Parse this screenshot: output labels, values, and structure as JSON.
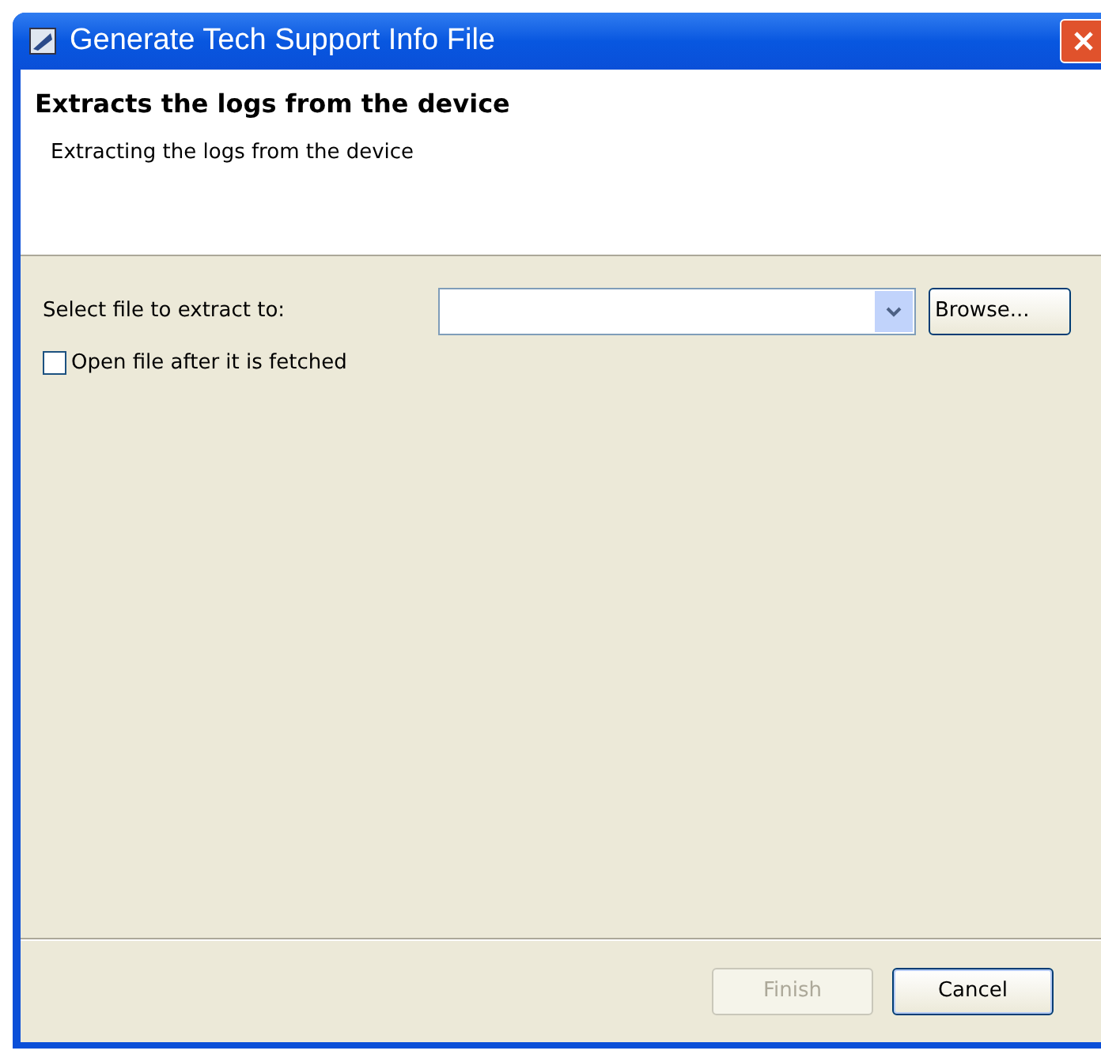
{
  "window": {
    "title": "Generate Tech Support Info File"
  },
  "header": {
    "title": "Extracts the logs from the device",
    "description": "Extracting the logs from the device"
  },
  "form": {
    "file_label": "Select file to extract to:",
    "browse_button": "Browse...",
    "open_after": {
      "label": "Open file after it is fetched",
      "checked": false
    }
  },
  "buttons": [
    {
      "label": "Finish",
      "disabled": true
    },
    {
      "label": "Cancel",
      "disabled": false
    }
  ]
}
